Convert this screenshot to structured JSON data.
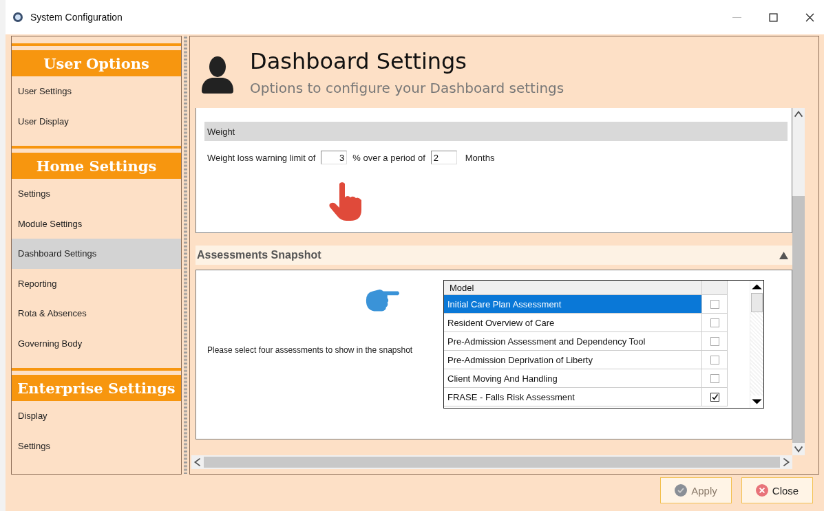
{
  "window": {
    "title": "System Configuration"
  },
  "sidebar": {
    "sections": [
      {
        "title": "User Options",
        "items": [
          {
            "label": "User Settings",
            "selected": false
          },
          {
            "label": "User Display",
            "selected": false
          }
        ]
      },
      {
        "title": "Home Settings",
        "items": [
          {
            "label": "Settings",
            "selected": false
          },
          {
            "label": "Module Settings",
            "selected": false
          },
          {
            "label": "Dashboard Settings",
            "selected": true
          },
          {
            "label": "Reporting",
            "selected": false
          },
          {
            "label": "Rota & Absences",
            "selected": false
          },
          {
            "label": "Governing Body",
            "selected": false
          }
        ]
      },
      {
        "title": "Enterprise Settings",
        "items": [
          {
            "label": "Display",
            "selected": false
          },
          {
            "label": "Settings",
            "selected": false
          }
        ]
      }
    ]
  },
  "header": {
    "title": "Dashboard Settings",
    "subtitle": "Options to configure your Dashboard settings"
  },
  "weight": {
    "heading": "Weight",
    "label_before": "Weight loss warning limit of",
    "limit_value": "3",
    "label_middle": "% over a period of",
    "period_value": "2",
    "unit": "Months"
  },
  "assessments": {
    "heading": "Assessments Snapshot",
    "expanded": true,
    "prompt": "Please select four assessments to show in the snapshot",
    "table": {
      "columns": [
        "Model"
      ],
      "rows": [
        {
          "name": "Initial Care Plan Assessment",
          "selected": true,
          "checked": false
        },
        {
          "name": "Resident Overview of Care",
          "selected": false,
          "checked": false
        },
        {
          "name": "Pre-Admission Assessment and Dependency Tool",
          "selected": false,
          "checked": false
        },
        {
          "name": "Pre-Admission Deprivation of Liberty",
          "selected": false,
          "checked": false
        },
        {
          "name": "Client Moving And Handling",
          "selected": false,
          "checked": false
        },
        {
          "name": "FRASE - Falls Risk Assessment",
          "selected": false,
          "checked": true
        }
      ]
    }
  },
  "buttons": [
    {
      "label": "Apply",
      "kind": "apply",
      "disabled": true
    },
    {
      "label": "Close",
      "kind": "close",
      "disabled": false
    }
  ]
}
